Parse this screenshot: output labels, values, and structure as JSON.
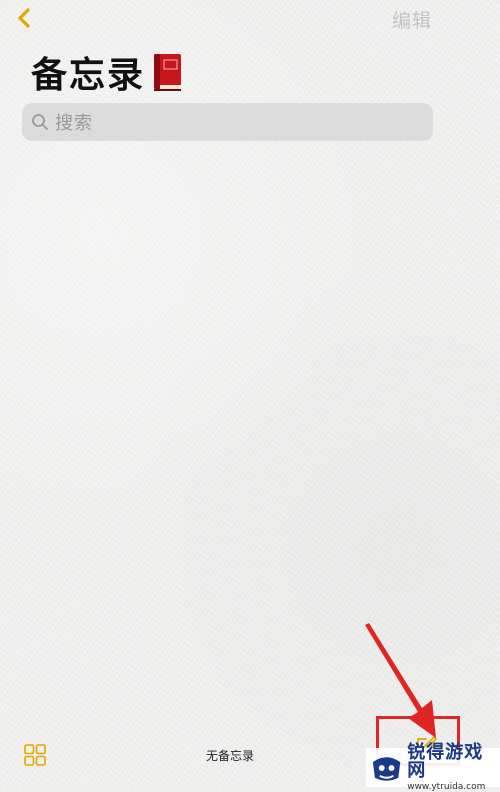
{
  "nav": {
    "back_icon": "chevron-left-icon",
    "edit_label": "编辑"
  },
  "header": {
    "title": "备忘录",
    "title_emoji": "red-book-emoji"
  },
  "search": {
    "icon": "search-icon",
    "placeholder": "搜索"
  },
  "toolbar": {
    "gallery_icon": "grid-icon",
    "note_count": "无备忘录",
    "compose_icon": "compose-icon"
  },
  "watermark": {
    "title": "锐得游戏网",
    "url": "www.ytruida.com"
  },
  "colors": {
    "accent": "#e1a800",
    "background": "#efefee",
    "annotation": "#e02525",
    "watermark_blue": "#1a3a8a"
  }
}
